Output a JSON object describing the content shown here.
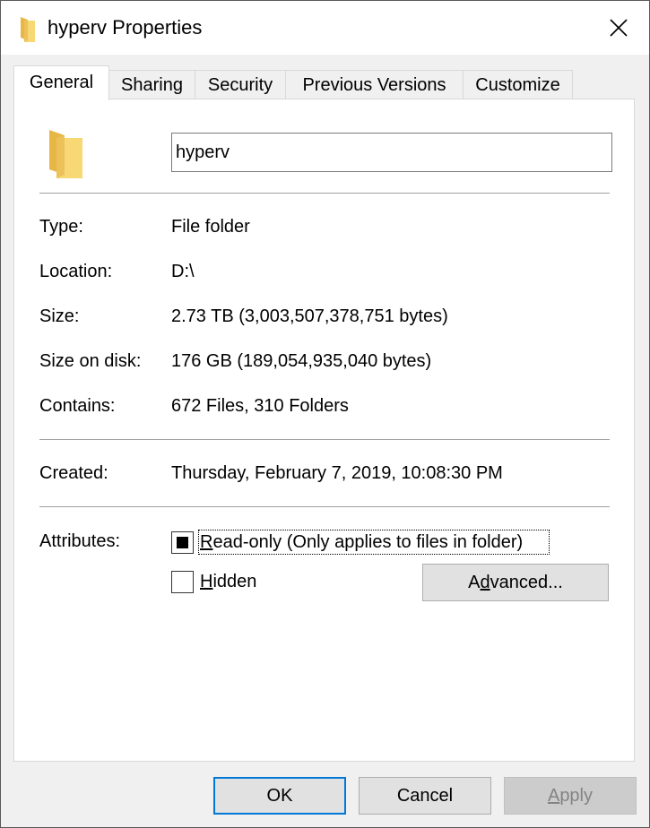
{
  "window": {
    "title": "hyperv Properties",
    "icon": "folder-icon"
  },
  "tabs": [
    {
      "label": "General",
      "active": true
    },
    {
      "label": "Sharing",
      "active": false
    },
    {
      "label": "Security",
      "active": false
    },
    {
      "label": "Previous Versions",
      "active": false
    },
    {
      "label": "Customize",
      "active": false
    }
  ],
  "general": {
    "name_value": "hyperv",
    "type_label": "Type:",
    "type_value": "File folder",
    "location_label": "Location:",
    "location_value": "D:\\",
    "size_label": "Size:",
    "size_value": "2.73 TB (3,003,507,378,751 bytes)",
    "size_on_disk_label": "Size on disk:",
    "size_on_disk_value": "176 GB (189,054,935,040 bytes)",
    "contains_label": "Contains:",
    "contains_value": "672 Files, 310 Folders",
    "created_label": "Created:",
    "created_value": "Thursday, February 7, 2019, 10:08:30 PM",
    "attributes_label": "Attributes:",
    "readonly": {
      "mnemonic": "R",
      "rest": "ead-only (Only applies to files in folder)",
      "state": "indeterminate"
    },
    "hidden": {
      "mnemonic": "H",
      "rest": "idden",
      "checked": false
    },
    "advanced_button": {
      "before": "A",
      "mnemonic": "d",
      "after": "vanced..."
    }
  },
  "buttons": {
    "ok": "OK",
    "cancel": "Cancel",
    "apply": {
      "mnemonic": "A",
      "rest": "pply",
      "enabled": false
    }
  },
  "colors": {
    "folder_yellow": "#f8d775",
    "folder_shadow": "#e6b745",
    "accent": "#0078d7"
  }
}
